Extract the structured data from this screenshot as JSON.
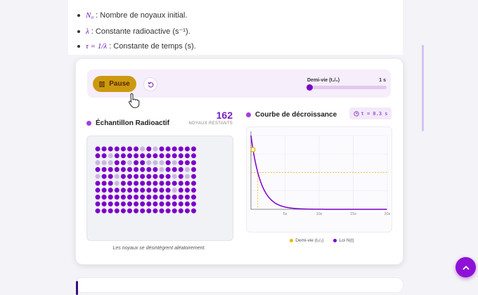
{
  "definitions": [
    {
      "symbol": "N₀",
      "text": ": Nombre de noyaux initial."
    },
    {
      "symbol": "λ",
      "text": ": Constante radioactive (s⁻¹)."
    },
    {
      "symbol": "τ = 1/λ",
      "text": ": Constante de temps (s)."
    }
  ],
  "toolbar": {
    "pause_label": "Pause",
    "halflife_label": "Demi-vie (t₁/₂)",
    "halflife_value": "1 s",
    "halflife_fraction": 0.0
  },
  "sample": {
    "title": "Échantillon Radioactif",
    "count": "162",
    "count_label": "NOYAUX RESTANTS",
    "caption": "Les noyaux se désintègrent aléatoirement.",
    "rows": 10,
    "cols": 16,
    "total": 184
  },
  "curve": {
    "title": "Courbe de décroissance",
    "time_label": "t = 0.3 s"
  },
  "colors": {
    "accent": "#7b00c9",
    "gold": "#cc9a10",
    "decayed": "#c9b6e0"
  },
  "chart_data": {
    "type": "line",
    "x_ticks": [
      "5s",
      "10s",
      "15s",
      "20s"
    ],
    "xlim": [
      0,
      20
    ],
    "ylim": [
      0,
      1
    ],
    "grid": true,
    "series": [
      {
        "name": "Loi N(t)",
        "x": [
          0,
          0.5,
          1,
          1.5,
          2,
          3,
          4,
          5,
          6,
          8,
          10,
          15,
          20
        ],
        "y": [
          1,
          0.71,
          0.5,
          0.35,
          0.25,
          0.125,
          0.0625,
          0.031,
          0.016,
          0.004,
          0.001,
          0.0,
          0.0
        ]
      },
      {
        "name": "Demi-vie (t₁/₂)",
        "x": [
          1,
          1
        ],
        "y": [
          0,
          0.5
        ]
      }
    ],
    "current_point": {
      "x": 0.3,
      "y": 0.81
    },
    "legend": [
      "Demi-vie (t₁/₂)",
      "Loi N(t)"
    ],
    "legend_position": "bottom"
  }
}
